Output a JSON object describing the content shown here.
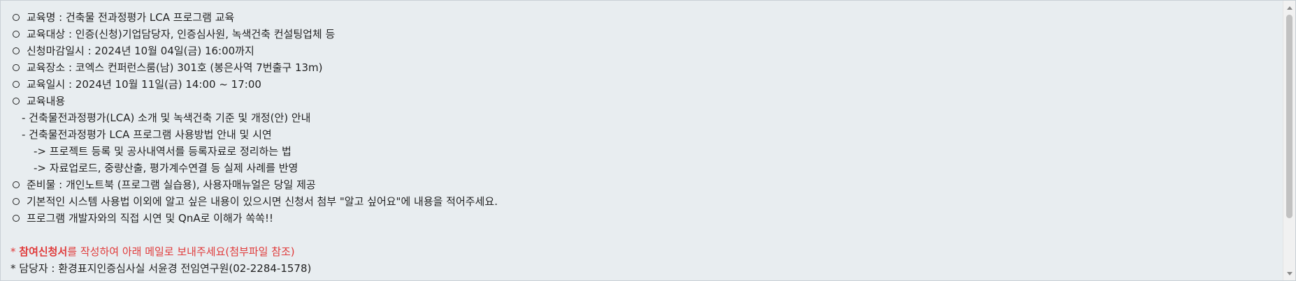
{
  "info_items": {
    "course_name": "교육명 : 건축물 전과정평가 LCA 프로그램 교육",
    "target": "교육대상 : 인증(신청)기업담당자, 인증심사원, 녹색건축 컨설팅업체 등",
    "deadline": "신청마감일시 : 2024년 10월 04일(금) 16:00까지",
    "location": "교육장소 : 코엑스 컨퍼런스룸(남) 301호 (봉은사역 7번출구 13m)",
    "datetime": "교육일시 : 2024년 10월 11일(금) 14:00 ~ 17:00",
    "content_heading": "교육내용"
  },
  "content_lines": {
    "sub1": "- 건축물전과정평가(LCA) 소개 및 녹색건축 기준 및 개정(안) 안내",
    "sub2": "- 건축물전과정평가 LCA 프로그램 사용방법 안내 및 시연",
    "sub2a": "-> 프로젝트 등록 및 공사내역서를 등록자료로 정리하는 법",
    "sub2b": "-> 자료업로드, 중량산출, 평가계수연결 등 실제 사례를 반영"
  },
  "extra_items": {
    "materials": "준비물 : 개인노트북 (프로그램 실습용), 사용자매뉴얼은 당일 제공",
    "questions": "기본적인 시스템 사용법 이외에 알고 싶은 내용이 있으시면 신청서 첨부 \"알고 싶어요\"에 내용을 적어주세요.",
    "demo": "프로그램 개발자와의 직접 시연 및 QnA로 이해가 쏙쏙!!"
  },
  "notice": {
    "prefix": "* ",
    "bold_part": "참여신청서",
    "rest": "를 작성하여 아래 메일로 보내주세요(첨부파일 참조)",
    "color": "#e03a3a"
  },
  "contact": "* 담당자 : 환경표지인증심사실 서윤경 전임연구원(02-2284-1578)"
}
